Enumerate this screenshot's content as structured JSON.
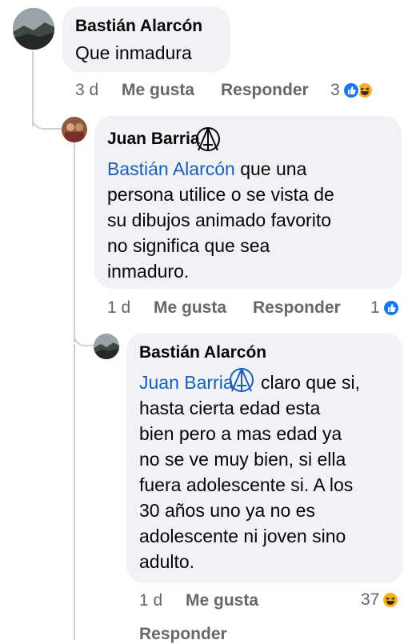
{
  "comments": [
    {
      "author": "Bastián Alarcón",
      "text": "Que inmadura",
      "time": "3 d",
      "like_label": "Me gusta",
      "reply_label": "Responder",
      "reaction_count": "3",
      "reactions": [
        "like-icon",
        "haha-icon"
      ]
    },
    {
      "author": "Juan Barria",
      "mention": "Bastián Alarcón",
      "text_lines": [
        " que una",
        "persona utilice o se vista de",
        "su dibujos animado favorito",
        "no significa que sea",
        "inmaduro."
      ],
      "time": "1 d",
      "like_label": "Me gusta",
      "reply_label": "Responder",
      "reaction_count": "1",
      "reactions": [
        "like-icon"
      ]
    },
    {
      "author": "Bastián Alarcón",
      "mention": "Juan Barria",
      "text_lines": [
        " claro que si,",
        "hasta cierta edad esta",
        "bien pero a mas edad ya",
        "no se ve muy bien, si ella",
        "fuera adolescente si. A los",
        "30 años uno ya no es",
        "adolescente ni joven sino",
        "adulto."
      ],
      "time": "1 d",
      "like_label": "Me gusta",
      "reply_label": "Responder",
      "reaction_count": "37",
      "reactions": [
        "haha-icon"
      ]
    }
  ],
  "colors": {
    "bubble": "#f0f2f5",
    "mention": "#1a5fb4",
    "meta": "#65676b",
    "like": "#1877f2",
    "haha": "#f7b125"
  }
}
